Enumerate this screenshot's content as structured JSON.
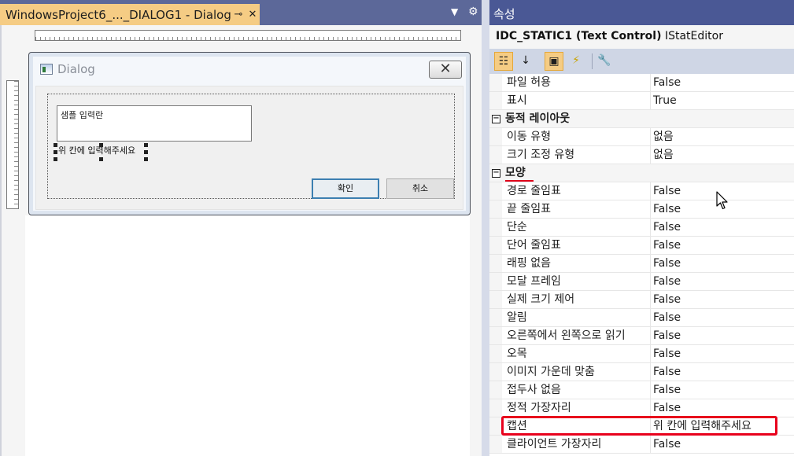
{
  "editor": {
    "tab_title": "WindowsProject6_..._DIALOG1 - Dialog",
    "pin_glyph": "⊸",
    "close_glyph": "✕",
    "overflow_glyph": "▼",
    "gear_glyph": "⚙"
  },
  "dialog": {
    "title": "Dialog",
    "close_glyph": "✕",
    "edit_text": "샘플 입력란",
    "static_text": "위 칸에 입력해주세요",
    "ok_label": "확인",
    "cancel_label": "취소"
  },
  "properties": {
    "panel_title": "속성",
    "object_id": "IDC_STATIC1 (Text Control)",
    "object_editor": "IStatEditor",
    "toolbar": {
      "categorized_glyph": "☷",
      "alphabetical_glyph": "↓",
      "properties_glyph": "▣",
      "events_glyph": "⚡",
      "pages_glyph": "🔧"
    },
    "rows": [
      {
        "kind": "prop",
        "name": "파일 허용",
        "value": "False"
      },
      {
        "kind": "prop",
        "name": "표시",
        "value": "True"
      },
      {
        "kind": "cat",
        "name": "동적 레이아웃",
        "expander": "−"
      },
      {
        "kind": "prop",
        "name": "이동 유형",
        "value": "없음"
      },
      {
        "kind": "prop",
        "name": "크기 조정 유형",
        "value": "없음"
      },
      {
        "kind": "cat",
        "name": "모양",
        "expander": "−"
      },
      {
        "kind": "prop",
        "name": "경로 줄임표",
        "value": "False"
      },
      {
        "kind": "prop",
        "name": "끝 줄임표",
        "value": "False"
      },
      {
        "kind": "prop",
        "name": "단순",
        "value": "False"
      },
      {
        "kind": "prop",
        "name": "단어 줄임표",
        "value": "False"
      },
      {
        "kind": "prop",
        "name": "래핑 없음",
        "value": "False"
      },
      {
        "kind": "prop",
        "name": "모달 프레임",
        "value": "False"
      },
      {
        "kind": "prop",
        "name": "실제 크기 제어",
        "value": "False"
      },
      {
        "kind": "prop",
        "name": "알림",
        "value": "False"
      },
      {
        "kind": "prop",
        "name": "오른쪽에서 왼쪽으로 읽기",
        "value": "False"
      },
      {
        "kind": "prop",
        "name": "오목",
        "value": "False"
      },
      {
        "kind": "prop",
        "name": "이미지 가운데 맞춤",
        "value": "False"
      },
      {
        "kind": "prop",
        "name": "접두사 없음",
        "value": "False"
      },
      {
        "kind": "prop",
        "name": "정적 가장자리",
        "value": "False"
      },
      {
        "kind": "prop",
        "name": "캡션",
        "value": "위 칸에 입력해주세요"
      },
      {
        "kind": "prop",
        "name": "클라이언트 가장자리",
        "value": "False"
      }
    ]
  },
  "colors": {
    "tab_active": "#f5cc84",
    "titlebar": "#4a5895",
    "highlight_red": "#e8001c"
  }
}
